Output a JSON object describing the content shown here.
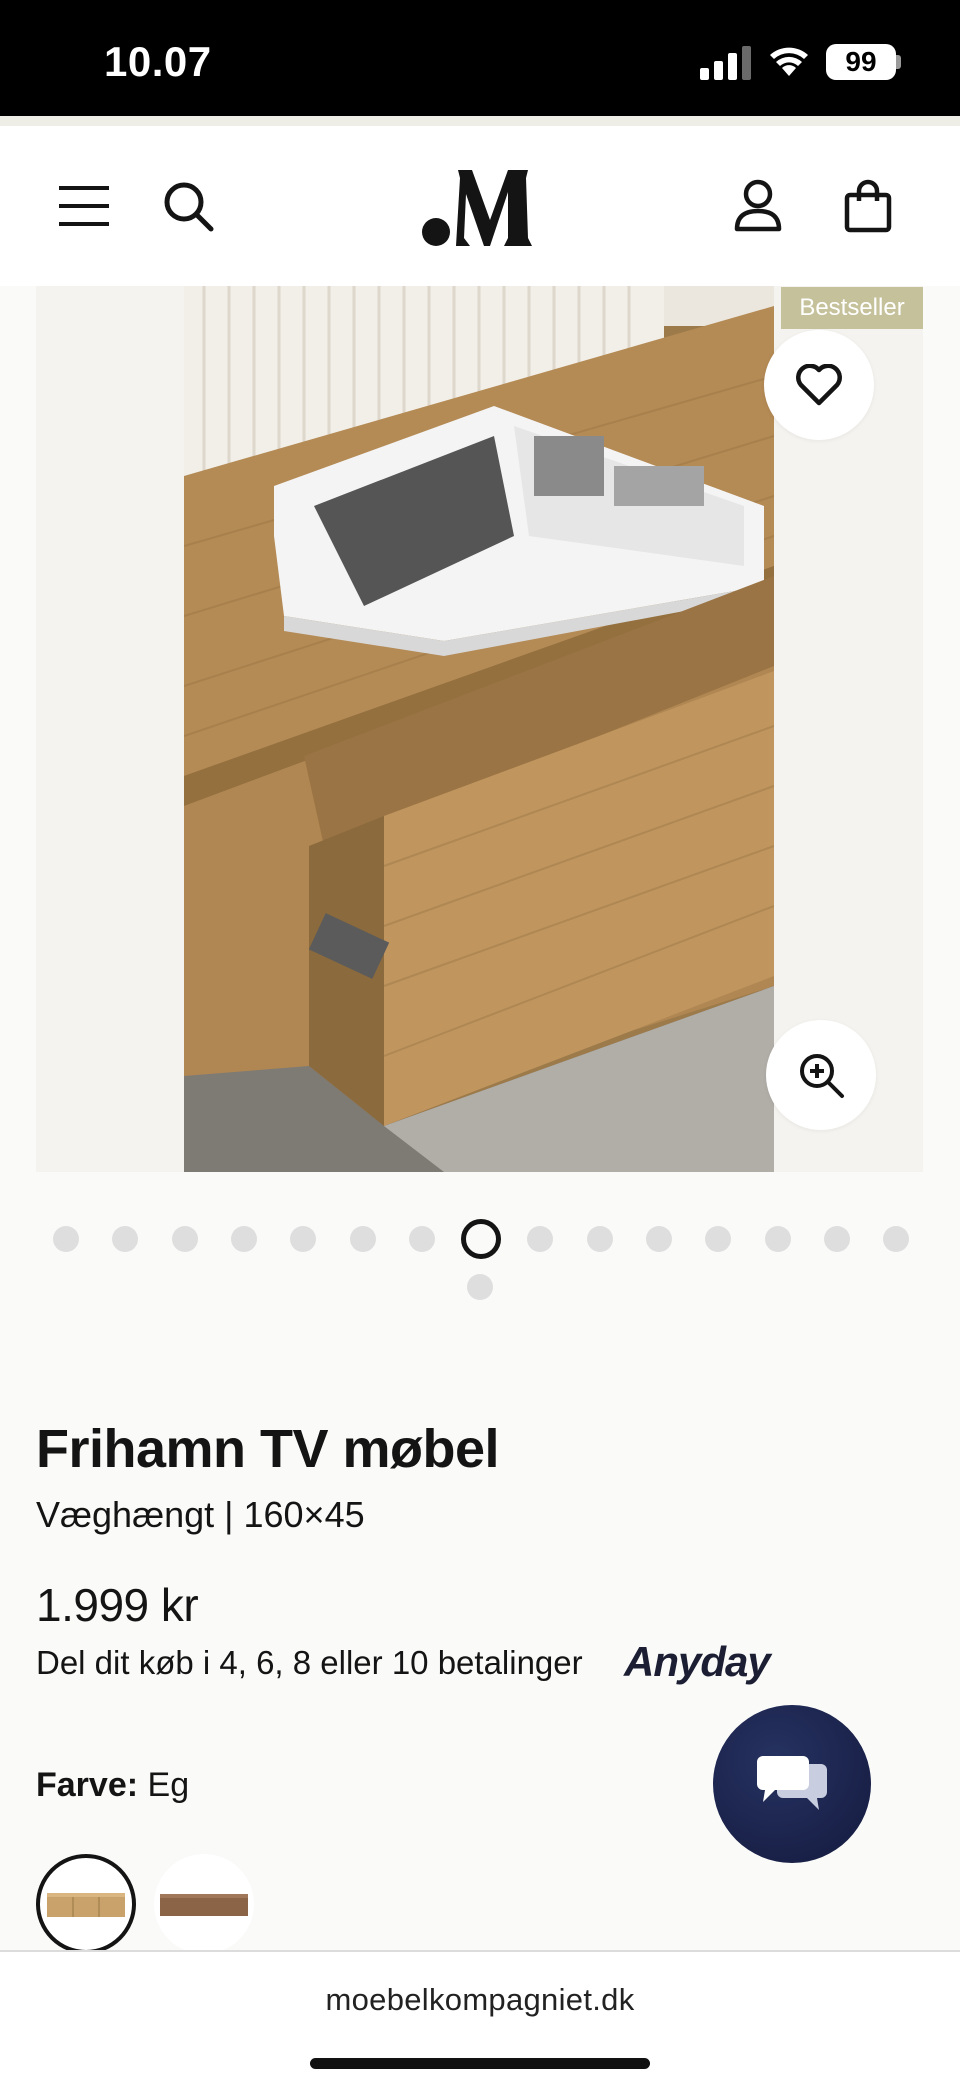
{
  "status_bar": {
    "time": "10.07",
    "battery": "99"
  },
  "header": {
    "menu_icon": "hamburger-menu-icon",
    "search_icon": "search-icon",
    "logo_icon": "monogram-logo",
    "account_icon": "user-icon",
    "cart_icon": "shopping-bag-icon"
  },
  "gallery": {
    "badge": "Bestseller",
    "favorite_icon": "heart-icon",
    "zoom_icon": "zoom-in-icon",
    "image_count": 16,
    "active_index": 7
  },
  "product": {
    "title": "Frihamn TV møbel",
    "subtitle": "Væghængt | 160×45",
    "price": "1.999 kr",
    "installments": "Del dit køb i 4, 6, 8 eller 10 betalinger",
    "installment_provider": "Anyday",
    "color_label": "Farve:",
    "color_value": "Eg",
    "swatches": [
      "Eg",
      "Valnød"
    ]
  },
  "chat": {
    "icon": "chat-bubbles-icon"
  },
  "browser": {
    "url": "moebelkompagniet.dk"
  },
  "colors": {
    "badge": "#c5c19a",
    "chat_button": "#1a2250",
    "anyday": "#1c1f33"
  }
}
